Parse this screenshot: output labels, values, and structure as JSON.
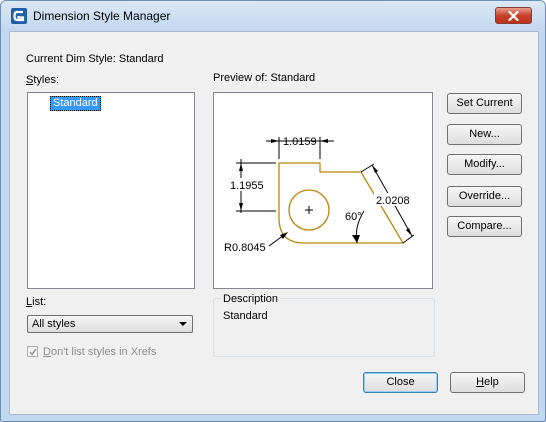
{
  "window": {
    "title": "Dimension Style Manager"
  },
  "current_style": {
    "label": "Current Dim Style: Standard"
  },
  "styles": {
    "label": "Styles:",
    "items": [
      "Standard"
    ]
  },
  "preview": {
    "label": "Preview of: Standard",
    "dimensions": {
      "top": "1.0159",
      "left": "1.1955",
      "right": "2.0208",
      "angle": "60°",
      "radius": "R0.8045"
    }
  },
  "list": {
    "label": "List:",
    "selected": "All styles"
  },
  "xrefs_checkbox": {
    "label": "Don't list styles in Xrefs",
    "checked": true
  },
  "description": {
    "label": "Description",
    "value": "Standard"
  },
  "buttons": {
    "set_current": "Set Current",
    "new": "New...",
    "modify": "Modify...",
    "override": "Override...",
    "compare": "Compare...",
    "close": "Close",
    "help": "Help"
  },
  "colors": {
    "selection": "#3399ff",
    "shape_outline": "#b8860b",
    "close_button": "#c8412c"
  }
}
